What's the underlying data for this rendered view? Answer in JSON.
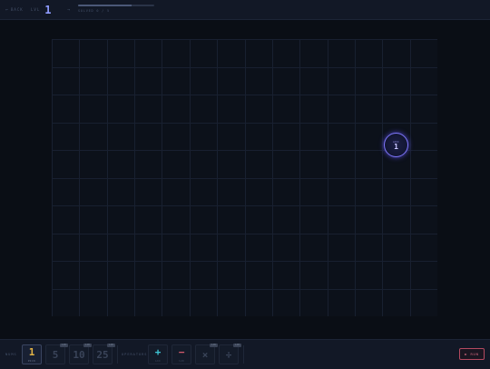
{
  "topbar": {
    "back_label": "BACK",
    "level_label": "LVL",
    "level_value": "1",
    "progress_text": "SOLVED 0 / 5",
    "progress_fraction": 0.7
  },
  "board": {
    "grid_cols": 14,
    "grid_rows": 10,
    "nodes": [
      {
        "tag": "ADD",
        "value": "1",
        "col": 12,
        "row": 4
      }
    ]
  },
  "bottombar": {
    "nums_label": "NUMS",
    "numbers": [
      {
        "value": "1",
        "caption": "PICK",
        "locked": false,
        "lock_text": ""
      },
      {
        "value": "5",
        "caption": "",
        "locked": true,
        "lock_text": "LCK"
      },
      {
        "value": "10",
        "caption": "",
        "locked": true,
        "lock_text": "LCK"
      },
      {
        "value": "25",
        "caption": "",
        "locked": true,
        "lock_text": "LCK"
      }
    ],
    "ops_label": "OPERATORS",
    "operators": [
      {
        "symbol": "+",
        "caption": "ADD",
        "locked": false,
        "lock_text": ""
      },
      {
        "symbol": "−",
        "caption": "SUB",
        "locked": false,
        "lock_text": ""
      },
      {
        "symbol": "×",
        "caption": "",
        "locked": true,
        "lock_text": "LCK"
      },
      {
        "symbol": "÷",
        "caption": "",
        "locked": true,
        "lock_text": "LCK"
      }
    ],
    "run_label": "▶ RUN"
  },
  "colors": {
    "accent": "#8f9cff",
    "number_active": "#e3b547",
    "plus": "#3fc6d6",
    "minus": "#d25a6c",
    "run": "#b44a60"
  }
}
